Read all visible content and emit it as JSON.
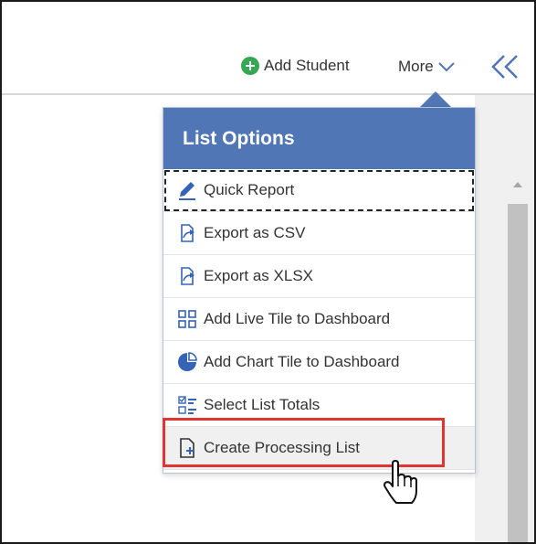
{
  "toolbar": {
    "add_student_label": "Add Student",
    "more_label": "More"
  },
  "dropdown": {
    "title": "List Options",
    "options": [
      {
        "label": "Quick Report",
        "icon": "pencil-icon"
      },
      {
        "label": "Export as CSV",
        "icon": "export-icon"
      },
      {
        "label": "Export as XLSX",
        "icon": "export-icon"
      },
      {
        "label": "Add Live Tile to Dashboard",
        "icon": "grid-icon"
      },
      {
        "label": "Add Chart Tile to Dashboard",
        "icon": "pie-chart-icon"
      },
      {
        "label": "Select List Totals",
        "icon": "checklist-icon"
      },
      {
        "label": "Create Processing List",
        "icon": "add-document-icon"
      }
    ]
  },
  "colors": {
    "accent": "#5176b5",
    "add_icon": "#34a853",
    "highlight_border": "#e03535"
  }
}
